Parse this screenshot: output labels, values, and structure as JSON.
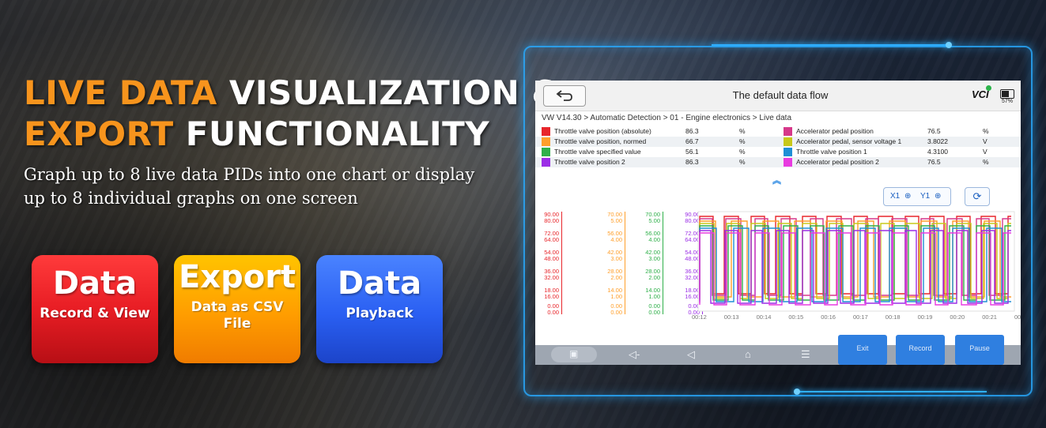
{
  "headline": {
    "line1_orange": "LIVE DATA",
    "line1_white": "VISUALIZATION &",
    "line2_orange": "EXPORT",
    "line2_white": "FUNCTIONALITY"
  },
  "subtitle": "Graph up to 8 live data PIDs into one chart or display up to 8 individual graphs on one screen",
  "features": [
    {
      "big": "Data",
      "small": "Record & View",
      "color": "#e81d24"
    },
    {
      "big": "Export",
      "small": "Data as CSV File",
      "color": "#ff9d00"
    },
    {
      "big": "Data",
      "small": "Playback",
      "color": "#2a5ff2"
    }
  ],
  "screen": {
    "title": "The default data flow",
    "vci": "VCI",
    "battery": "57%",
    "breadcrumb": "VW V14.30 > Automatic Detection  > 01 - Engine electronics > Live data",
    "pids": [
      {
        "name": "Throttle valve position (absolute)",
        "value": "86.3",
        "unit": "%",
        "color": "#e8262b"
      },
      {
        "name": "Accelerator pedal position",
        "value": "76.5",
        "unit": "%",
        "color": "#d6388a"
      },
      {
        "name": "Throttle valve position, normed",
        "value": "66.7",
        "unit": "%",
        "color": "#ff9f2b"
      },
      {
        "name": "Accelerator pedal, sensor voltage 1",
        "value": "3.8022",
        "unit": "V",
        "color": "#c8c81a"
      },
      {
        "name": "Throttle valve specified value",
        "value": "56.1",
        "unit": "%",
        "color": "#2fb04a"
      },
      {
        "name": "Throttle valve position 1",
        "value": "4.3100",
        "unit": "V",
        "color": "#1e8fd6"
      },
      {
        "name": "Throttle valve position 2",
        "value": "86.3",
        "unit": "%",
        "color": "#9b2ee6"
      },
      {
        "name": "Accelerator pedal position 2",
        "value": "76.5",
        "unit": "%",
        "color": "#e83be0"
      }
    ],
    "zoom_x": "X1",
    "zoom_y": "Y1",
    "axis_groups": [
      {
        "color": "#e8262b",
        "labels": [
          "90.00",
          "80.00",
          "72.00",
          "64.00",
          "54.00",
          "48.00",
          "36.00",
          "32.00",
          "18.00",
          "16.00",
          "0.00",
          "0.00"
        ]
      },
      {
        "color": "#ff9f2b",
        "labels": [
          "70.00",
          "5.00",
          "56.00",
          "4.00",
          "42.00",
          "3.00",
          "28.00",
          "2.00",
          "14.00",
          "1.00",
          "0.00",
          "0.00"
        ]
      },
      {
        "color": "#2fb04a",
        "labels": [
          "70.00",
          "5.00",
          "56.00",
          "4.00",
          "42.00",
          "3.00",
          "28.00",
          "2.00",
          "14.00",
          "1.00",
          "0.00",
          "0.00"
        ]
      },
      {
        "color": "#9b2ee6",
        "labels": [
          "90.00",
          "80.00",
          "72.00",
          "64.00",
          "54.00",
          "48.00",
          "36.00",
          "32.00",
          "18.00",
          "16.00",
          "0.00",
          "0.00"
        ]
      }
    ],
    "time_labels": [
      "00:12",
      "00:13",
      "00:14",
      "00:15",
      "00:16",
      "00:17",
      "00:18",
      "00:19",
      "00:20",
      "00:21",
      "00:22"
    ],
    "actions": [
      "Exit",
      "Record",
      "Pause"
    ]
  }
}
